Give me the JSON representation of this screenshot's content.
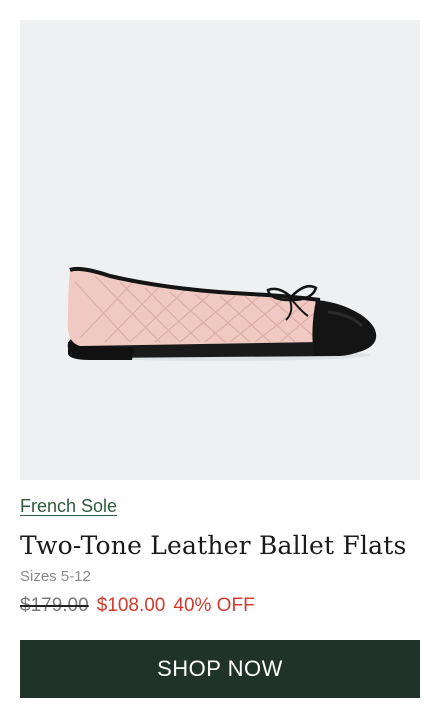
{
  "product": {
    "image_alt": "Two-Tone Leather Ballet Flats product photo",
    "brand": "French Sole",
    "title": "Two-Tone Leather Ballet Flats",
    "sizes": "Sizes 5-12",
    "original_price": "$179.00",
    "sale_price": "$108.00",
    "discount": "40% OFF"
  },
  "cta": {
    "label": "SHOP NOW"
  },
  "colors": {
    "accent_green": "#2e5a3e",
    "button_bg": "#20332a",
    "sale_red": "#d43a2c",
    "shoe_pink": "#f0c9c2",
    "shoe_black": "#141414"
  }
}
